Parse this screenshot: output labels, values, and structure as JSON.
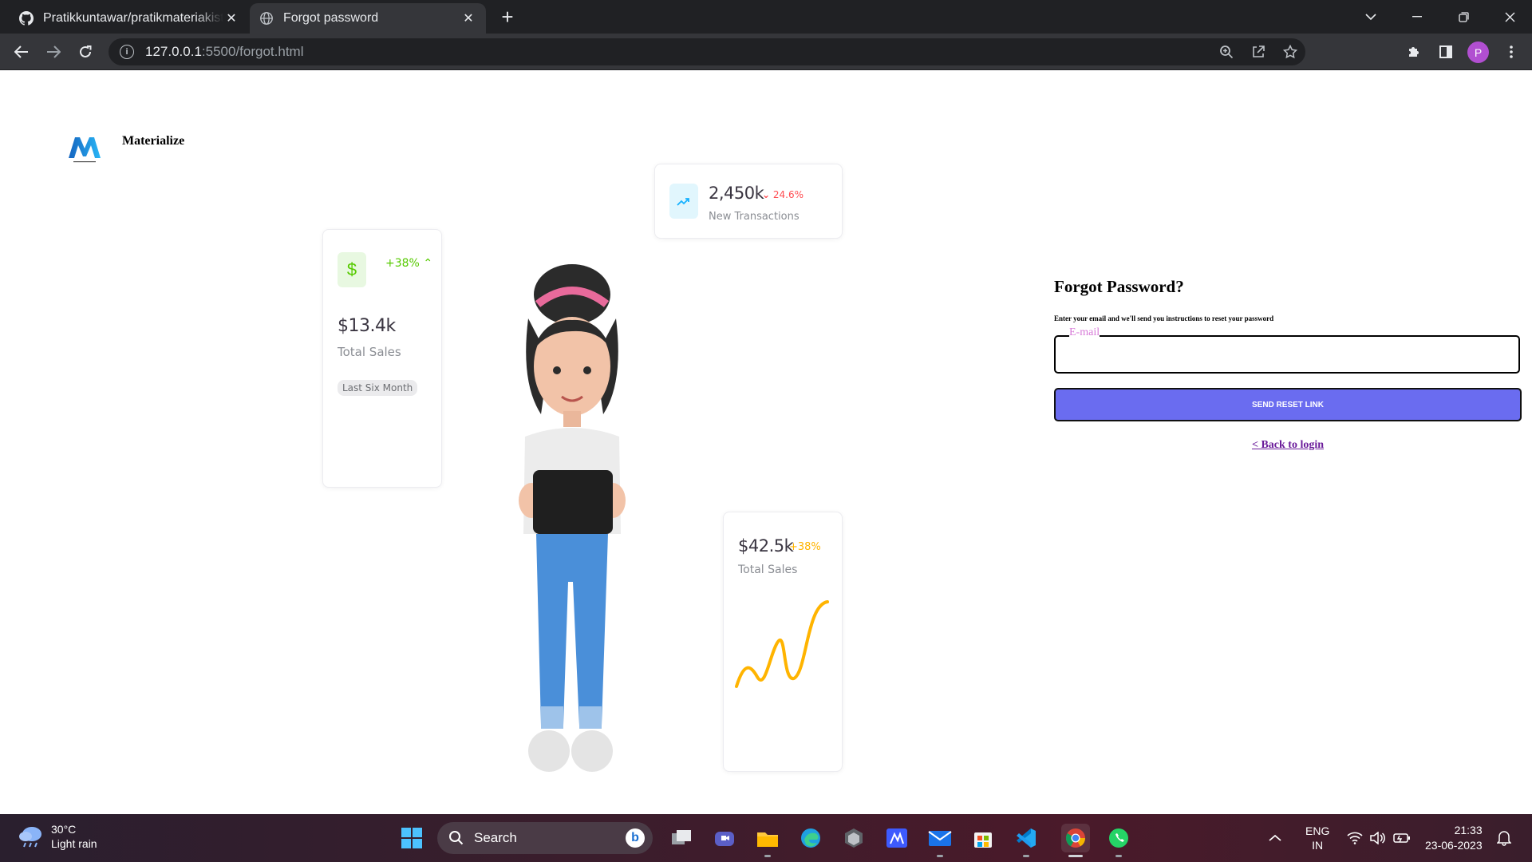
{
  "browser": {
    "tabs": [
      {
        "title": "Pratikkuntawar/pratikmateriakisti",
        "active": false,
        "icon": "github-icon"
      },
      {
        "title": "Forgot password",
        "active": true,
        "icon": "globe-icon"
      }
    ],
    "url_host": "127.0.0.1",
    "url_path": ":5500/forgot.html",
    "profile_initial": "P"
  },
  "page": {
    "brand": "Materialize",
    "logo_letter": "M",
    "cards": {
      "sales_small": {
        "percent": "+38%",
        "value": "$13.4k",
        "label": "Total Sales",
        "chip": "Last Six Month"
      },
      "transactions": {
        "value": "2,450k",
        "percent": "24.6%",
        "label": "New Transactions"
      },
      "sales_large": {
        "value": "$42.5k",
        "percent": "+38%",
        "label": "Total Sales"
      }
    },
    "form": {
      "title": "Forgot Password?",
      "subtitle": "Enter your email and we'll send you instructions to reset your password",
      "email_label": "E-mail",
      "email_value": "",
      "button": "SEND RESET LINK",
      "back_link": "< Back to login"
    },
    "colors": {
      "primary": "#6a6cf0",
      "success": "#56ca00",
      "error": "#ff4c51",
      "warning": "#ffb400",
      "info": "#16b1ff"
    }
  },
  "taskbar": {
    "weather_temp": "30°C",
    "weather_desc": "Light rain",
    "search_placeholder": "Search",
    "lang_top": "ENG",
    "lang_bottom": "IN",
    "time": "21:33",
    "date": "23-06-2023"
  }
}
